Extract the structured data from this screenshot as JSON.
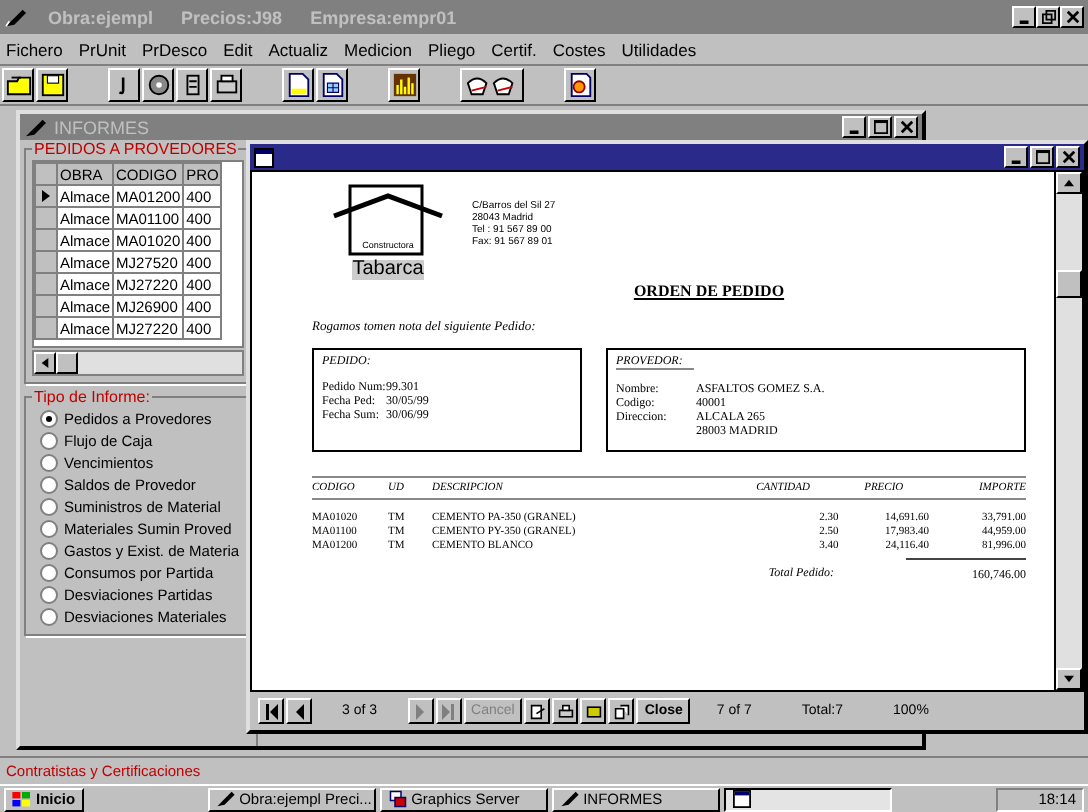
{
  "window": {
    "title_parts": [
      "Obra:ejempl",
      "Precios:J98",
      "Empresa:empr01"
    ]
  },
  "menu": [
    "Fichero",
    "PrUnit",
    "PrDesco",
    "Edit",
    "Actualiz",
    "Medicion",
    "Pliego",
    "Certif.",
    "Costes",
    "Utilidades"
  ],
  "informes_window": {
    "title": "INFORMES",
    "orders_group": {
      "title": "PEDIDOS A PROVEDORES",
      "columns": [
        "OBRA",
        "CODIGO",
        "PRO"
      ],
      "rows": [
        {
          "cells": [
            "Almace",
            "MA01200",
            "400"
          ],
          "selected": true
        },
        {
          "cells": [
            "Almace",
            "MA01100",
            "400"
          ],
          "selected": false
        },
        {
          "cells": [
            "Almace",
            "MA01020",
            "400"
          ],
          "selected": false
        },
        {
          "cells": [
            "Almace",
            "MJ27520",
            "400"
          ],
          "selected": false
        },
        {
          "cells": [
            "Almace",
            "MJ27220",
            "400"
          ],
          "selected": false
        },
        {
          "cells": [
            "Almace",
            "MJ26900",
            "400"
          ],
          "selected": false
        },
        {
          "cells": [
            "Almace",
            "MJ27220",
            "400"
          ],
          "selected": false
        }
      ]
    },
    "report_type": {
      "title": "Tipo de Informe:",
      "options": [
        {
          "label": "Pedidos a Provedores",
          "selected": true
        },
        {
          "label": "Flujo de Caja",
          "selected": false
        },
        {
          "label": "Vencimientos",
          "selected": false
        },
        {
          "label": "Saldos de Provedor",
          "selected": false
        },
        {
          "label": "Suministros de Material",
          "selected": false
        },
        {
          "label": "Materiales Sumin Proved",
          "selected": false
        },
        {
          "label": "Gastos y Exist. de Materia",
          "selected": false
        },
        {
          "label": "Consumos por Partida",
          "selected": false
        },
        {
          "label": "Desviaciones Partidas",
          "selected": false
        },
        {
          "label": "Desviaciones Materiales",
          "selected": false
        }
      ]
    }
  },
  "preview_window": {
    "company": {
      "tagline": "Constructora",
      "name": "Tabarca",
      "address": [
        "C/Barros del Sil 27",
        "28043 Madrid",
        "Tel : 91 567 89 00",
        "Fax: 91 567 89 01"
      ]
    },
    "title": "ORDEN DE PEDIDO",
    "intro": "Rogamos tomen nota del siguiente Pedido:",
    "order_box": {
      "heading": "PEDIDO:",
      "fields": [
        {
          "label": "Pedido Num:",
          "value": "99.301"
        },
        {
          "label": "Fecha Ped:",
          "value": "30/05/99"
        },
        {
          "label": "Fecha Sum:",
          "value": "30/06/99"
        }
      ]
    },
    "supplier_box": {
      "heading": "PROVEDOR:",
      "fields": [
        {
          "label": "Nombre:",
          "value": "ASFALTOS GOMEZ S.A."
        },
        {
          "label": "Codigo:",
          "value": "40001"
        },
        {
          "label": "Direccion:",
          "value": "ALCALA 265"
        },
        {
          "value": "28003  MADRID"
        }
      ]
    },
    "table": {
      "columns": [
        "CODIGO",
        "UD",
        "DESCRIPCION",
        "CANTIDAD",
        "PRECIO",
        "IMPORTE"
      ],
      "rows": [
        [
          "MA01020",
          "TM",
          "CEMENTO PA-350 (GRANEL)",
          "2.30",
          "14,691.60",
          "33,791.00"
        ],
        [
          "MA01100",
          "TM",
          "CEMENTO PY-350 (GRANEL)",
          "2.50",
          "17,983.40",
          "44,959.00"
        ],
        [
          "MA01200",
          "TM",
          "CEMENTO BLANCO",
          "3.40",
          "24,116.40",
          "81,996.00"
        ]
      ]
    },
    "total": {
      "label": "Total Pedido:",
      "value": "160,746.00"
    },
    "nav": {
      "buttons": [
        {
          "kind": "first",
          "disabled": false
        },
        {
          "kind": "prev",
          "disabled": false
        },
        {
          "kind": "next",
          "disabled": true
        },
        {
          "kind": "last",
          "disabled": true
        }
      ],
      "page": "3 of 3",
      "cancel": {
        "label": "Cancel",
        "disabled": true
      },
      "close": "Close",
      "records": "7 of 7",
      "total": "Total:7",
      "zoom": "100%"
    }
  },
  "status_text": "Contratistas y Certificaciones",
  "taskbar": {
    "start": "Inicio",
    "tasks": [
      {
        "kind": "pen",
        "label": "Obra:ejempl   Preci...",
        "selected": false
      },
      {
        "kind": "graphics",
        "label": "Graphics Server",
        "selected": false
      },
      {
        "kind": "pen",
        "label": "INFORMES",
        "selected": false
      },
      {
        "kind": "window",
        "selected": true
      }
    ],
    "clock": "18:14"
  }
}
